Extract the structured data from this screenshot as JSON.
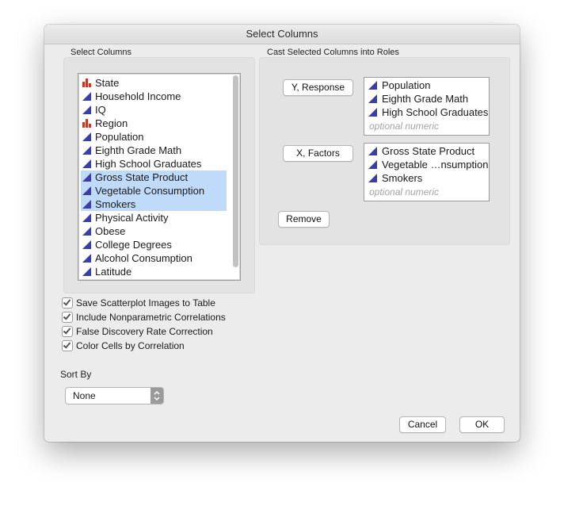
{
  "window": {
    "title": "Select Columns"
  },
  "select_columns": {
    "label": "Select Columns",
    "items": [
      {
        "label": "State",
        "icon": "nominal-bar-icon",
        "selected": false
      },
      {
        "label": "Household Income",
        "icon": "continuous-triangle-icon",
        "selected": false
      },
      {
        "label": "IQ",
        "icon": "continuous-triangle-icon",
        "selected": false
      },
      {
        "label": "Region",
        "icon": "nominal-bar-icon",
        "selected": false
      },
      {
        "label": "Population",
        "icon": "continuous-triangle-icon",
        "selected": false
      },
      {
        "label": "Eighth Grade Math",
        "icon": "continuous-triangle-icon",
        "selected": false
      },
      {
        "label": "High School Graduates",
        "icon": "continuous-triangle-icon",
        "selected": false
      },
      {
        "label": "Gross State Product",
        "icon": "continuous-triangle-icon",
        "selected": true
      },
      {
        "label": "Vegetable Consumption",
        "icon": "continuous-triangle-icon",
        "selected": true
      },
      {
        "label": "Smokers",
        "icon": "continuous-triangle-icon",
        "selected": true
      },
      {
        "label": "Physical Activity",
        "icon": "continuous-triangle-icon",
        "selected": false
      },
      {
        "label": "Obese",
        "icon": "continuous-triangle-icon",
        "selected": false
      },
      {
        "label": "College Degrees",
        "icon": "continuous-triangle-icon",
        "selected": false
      },
      {
        "label": "Alcohol Consumption",
        "icon": "continuous-triangle-icon",
        "selected": false
      },
      {
        "label": "Latitude",
        "icon": "continuous-triangle-icon",
        "selected": false
      }
    ]
  },
  "roles": {
    "label": "Cast Selected Columns into Roles",
    "y": {
      "button": "Y, Response",
      "items": [
        "Population",
        "Eighth Grade Math",
        "High School Graduates"
      ],
      "placeholder": "optional numeric"
    },
    "x": {
      "button": "X, Factors",
      "items": [
        "Gross State Product",
        "Vegetable …nsumption",
        "Smokers"
      ],
      "placeholder": "optional numeric"
    },
    "remove_button": "Remove"
  },
  "options": [
    {
      "label": "Save Scatterplot Images to Table",
      "checked": true
    },
    {
      "label": "Include Nonparametric Correlations",
      "checked": true
    },
    {
      "label": "False Discovery Rate Correction",
      "checked": true
    },
    {
      "label": "Color Cells by Correlation",
      "checked": true
    }
  ],
  "sort_by": {
    "label": "Sort By",
    "value": "None"
  },
  "footer": {
    "cancel": "Cancel",
    "ok": "OK"
  },
  "colors": {
    "selection": "#bfdbf9",
    "continuous_icon": "#3a3fa8",
    "nominal_icon": "#c0392b"
  }
}
